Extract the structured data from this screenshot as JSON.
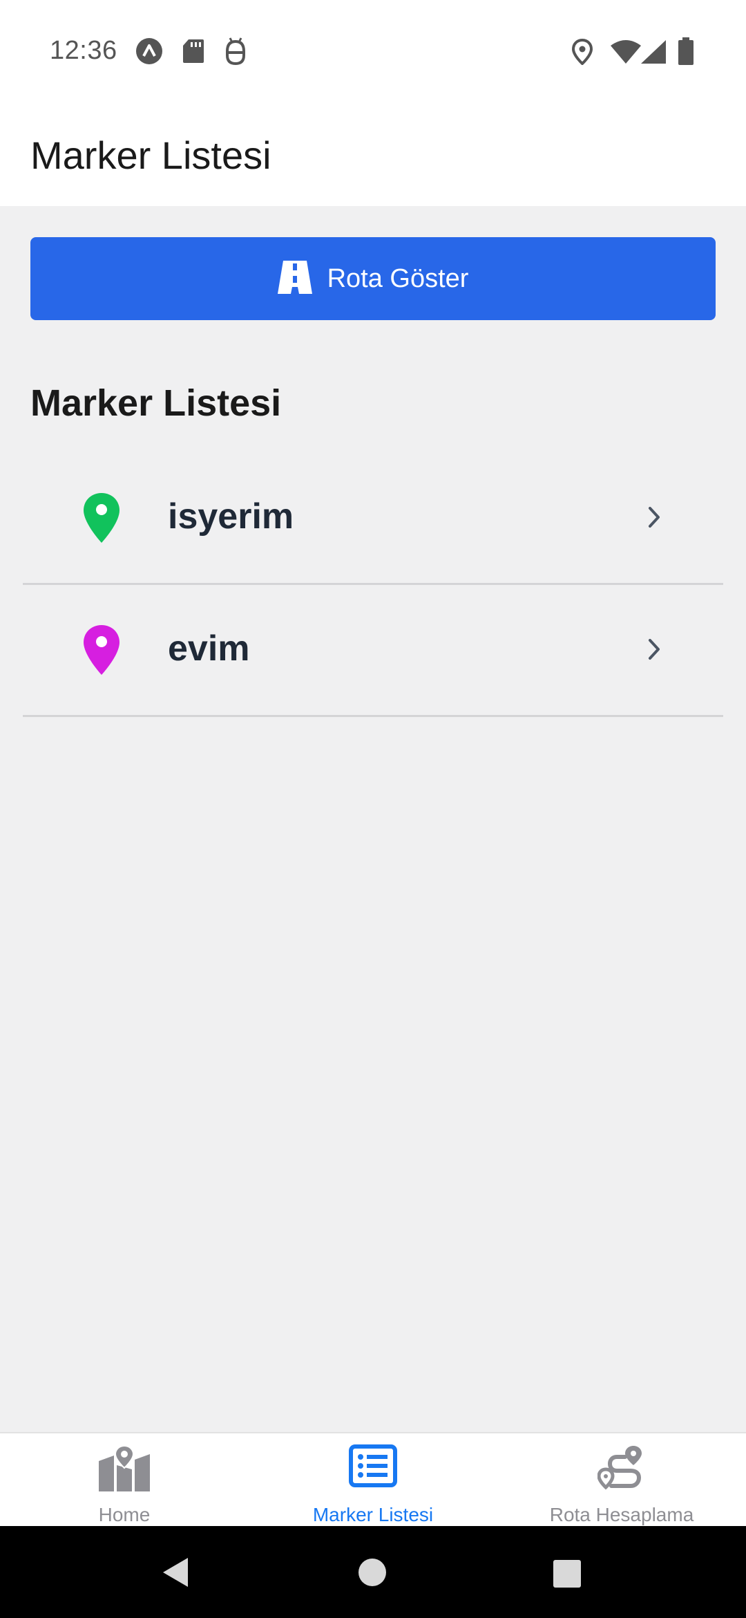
{
  "status_bar": {
    "time": "12:36",
    "left_icons": [
      "expo-icon",
      "sd-card-icon",
      "android-debug-icon"
    ],
    "right_icons": [
      "location-icon",
      "wifi-icon",
      "signal-icon",
      "battery-icon"
    ]
  },
  "header": {
    "title": "Marker Listesi"
  },
  "route_button": {
    "label": "Rota Göster",
    "icon": "road-icon",
    "color": "#2867e8"
  },
  "section_title": "Marker Listesi",
  "markers": [
    {
      "name": "isyerim",
      "pin_color": "#11c25c",
      "icon": "map-pin-icon"
    },
    {
      "name": "evim",
      "pin_color": "#d61fe0",
      "icon": "map-pin-icon"
    }
  ],
  "tabs": [
    {
      "label": "Home",
      "icon": "map-icon",
      "active": false
    },
    {
      "label": "Marker Listesi",
      "icon": "list-icon",
      "active": true
    },
    {
      "label": "Rota Hesaplama",
      "icon": "route-icon",
      "active": false
    }
  ],
  "colors": {
    "active_tab": "#1778f2",
    "inactive_tab": "#8e8e93",
    "background": "#f0f0f1"
  },
  "nav_bar": {
    "buttons": [
      "back-icon",
      "home-icon",
      "recents-icon"
    ]
  }
}
